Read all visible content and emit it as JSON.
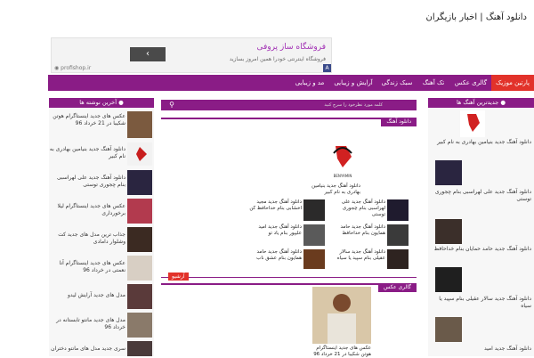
{
  "site": {
    "title": "دانلود آهنگ | اخبار بازیگران"
  },
  "ad": {
    "title": "فروشگاه ساز پروفی",
    "subtitle": "فروشگاه اینترنتی خودرا همین امروز بسازید",
    "domain": "profishop.ir",
    "mark": "A"
  },
  "nav": {
    "items": [
      {
        "label": "پارتین موزیک",
        "active": true
      },
      {
        "label": "گالری عکس"
      },
      {
        "label": "تک آهنگ"
      },
      {
        "label": "سبک زندگی"
      },
      {
        "label": "آرایش و زیبایی"
      },
      {
        "label": "مد و زیبایی"
      }
    ]
  },
  "left": {
    "header": "آخرین نوشته ها",
    "posts": [
      "عکس های جدید اینستاگرام هوتن شکیبا در 21 خرداد 96",
      "دانلود آهنگ جدید بنیامین بهادری به نام کبیر",
      "دانلود آهنگ جدید علی لهراسبی بنام چجوری توستی",
      "عکس های جدید اینستاگرام لیلا برخورداری",
      "جذاب ترین مدل های جدید کت وشلوار دامادی",
      "عکس های جدید اینستاگرام آنا نعمتی در خرداد 96",
      "مدل های جدید آرایش لیدو",
      "مدل های جدید مانتو تابستانه در خرداد 96",
      "سری جدید مدل های مانتو دختران"
    ]
  },
  "right": {
    "header": "جدیدترین آهنگ ها",
    "posts": [
      "دانلود آهنگ جدید بنیامین بهادری به نام کبیر",
      "دانلود آهنگ جدید علی لهراسبی بنام چجوری توستی",
      "دانلود آهنگ جدید حامد حمایان بنام خداحافظ",
      "دانلود آهنگ جدید سالار عقیلی بنام سپید یا سیاه",
      "دانلود آهنگ جدید امید"
    ]
  },
  "search": {
    "placeholder": "کلمه مورد نظرخود را سرچ کنید"
  },
  "music_section": {
    "tag": "دانلود آهنگ",
    "logo_text": "BENYAMIN",
    "featured": "دانلود آهنگ جدید بنیامین بهادری به نام کبیر",
    "items": [
      "دانلود آهنگ جدید علی لهراسبی بنام چجوری توستی",
      "دانلود آهنگ جدید حامد همایون بنام خداحافظ",
      "دانلود آهنگ جدید سالار عقیلی بنام سپید یا سیاه",
      "دانلود آهنگ جدید مجید اخشابی بنام خداحافظ کن",
      "دانلود آهنگ جدید امید علیپور بنام یاد تو",
      "دانلود آهنگ جدید حامد همایون بنام عشق ناب"
    ]
  },
  "archive": {
    "label": "آرشیو"
  },
  "gallery_section": {
    "tag": "گالری عکس",
    "caption": "عکس های جدید اینستاگرام هوتن شکیبا در 21 خرداد 96"
  }
}
